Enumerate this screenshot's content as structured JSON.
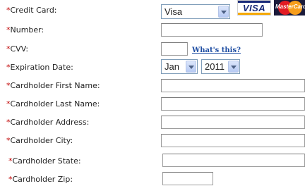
{
  "required_marker": "*",
  "labels": {
    "credit_card": "Credit Card:",
    "number": "Number:",
    "cvv": "CVV:",
    "expiration_date": "Expiration Date:",
    "first_name": "Cardholder First Name:",
    "last_name": "Cardholder Last Name:",
    "address": "Cardholder Address:",
    "city": "Cardholder City:",
    "state": "Cardholder State:",
    "zip": "Cardholder Zip:"
  },
  "fields": {
    "card_type": "Visa",
    "number": "",
    "cvv": "",
    "exp_month": "Jan",
    "exp_year": "2011",
    "first_name": "",
    "last_name": "",
    "address": "",
    "city": "",
    "state": "",
    "zip": ""
  },
  "links": {
    "whats_this": "What's this?"
  },
  "card_logos": {
    "visa": "VISA",
    "mastercard": "MasterCard"
  },
  "colors": {
    "required": "#c00000",
    "link": "#1f4ea3"
  }
}
